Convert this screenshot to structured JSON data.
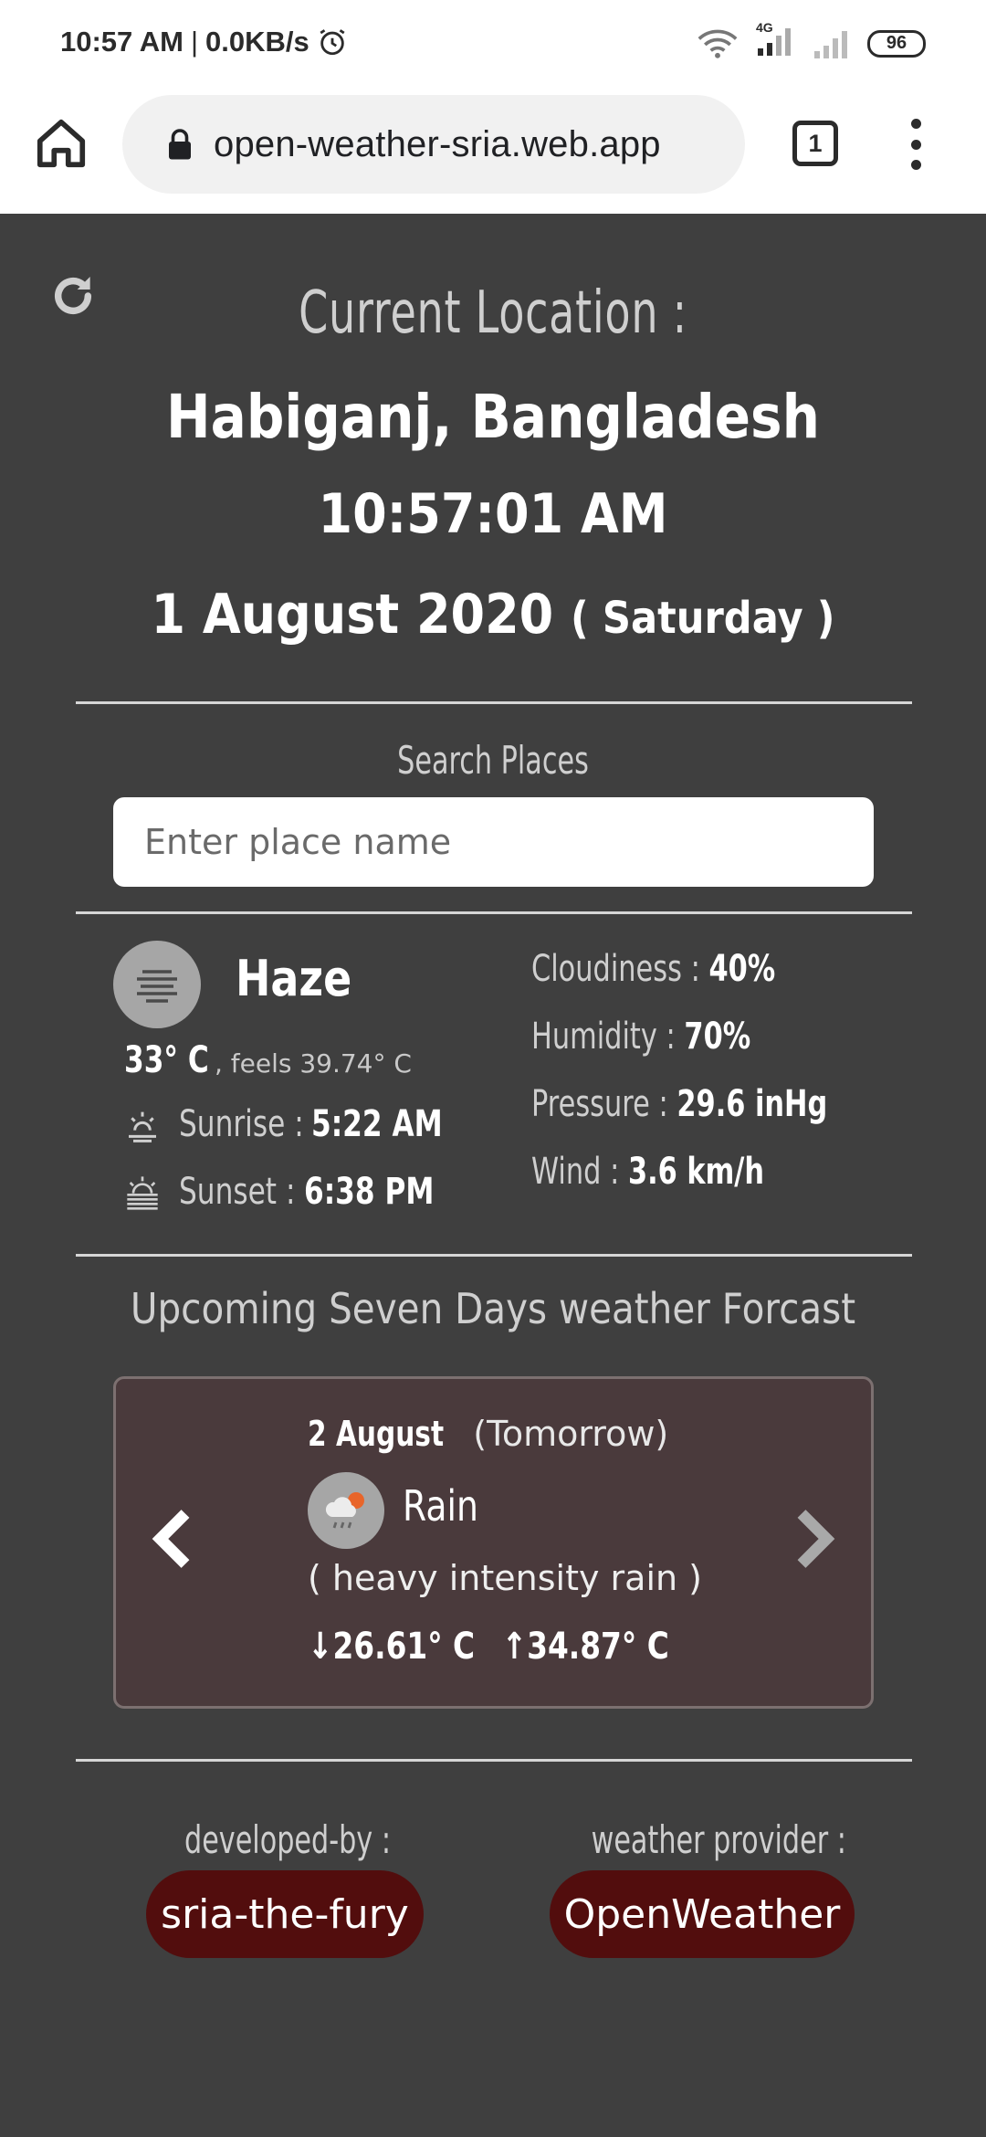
{
  "status_bar": {
    "time": "10:57 AM",
    "separator": "|",
    "net_speed": "0.0KB/s",
    "network_type": "4G",
    "battery": "96",
    "icons": [
      "alarm-icon",
      "wifi-icon",
      "signal-icon",
      "signal-icon-2",
      "battery-icon"
    ]
  },
  "browser": {
    "url": "open-weather-sria.web.app",
    "tab_count": "1",
    "icons": [
      "home-icon",
      "lock-icon",
      "tabs-icon",
      "more-vert-icon"
    ]
  },
  "location": {
    "heading": "Current Location :",
    "name": "Habiganj, Bangladesh",
    "time": "10:57:01 AM",
    "date": "1 August 2020",
    "day": "( Saturday )"
  },
  "search": {
    "label": "Search Places",
    "placeholder": "Enter place name"
  },
  "current": {
    "condition": "Haze",
    "temp": "33° C",
    "feels": ", feels 39.74° C",
    "sunrise_label": "Sunrise : ",
    "sunrise_value": "5:22 AM",
    "sunset_label": "Sunset : ",
    "sunset_value": "6:38 PM",
    "stats": [
      {
        "label": "Cloudiness : ",
        "value": "40%"
      },
      {
        "label": "Humidity : ",
        "value": "70%"
      },
      {
        "label": "Pressure : ",
        "value": "29.6 inHg"
      },
      {
        "label": "Wind : ",
        "value": "3.6 km/h"
      }
    ]
  },
  "forecast": {
    "title": "Upcoming Seven Days weather Forcast",
    "date": "2 August",
    "date_note": " (Tomorrow)",
    "condition": "Rain",
    "description": "( heavy intensity rain )",
    "low": "↓26.61° C",
    "high": "↑34.87° C"
  },
  "footer": {
    "developed_label": "developed-by :",
    "developer": "sria-the-fury",
    "provider_label": "weather provider :",
    "provider": "OpenWeather"
  },
  "colors": {
    "background": "#3f3f3f",
    "card": "#4a3a3c",
    "pill": "#520d0d"
  }
}
